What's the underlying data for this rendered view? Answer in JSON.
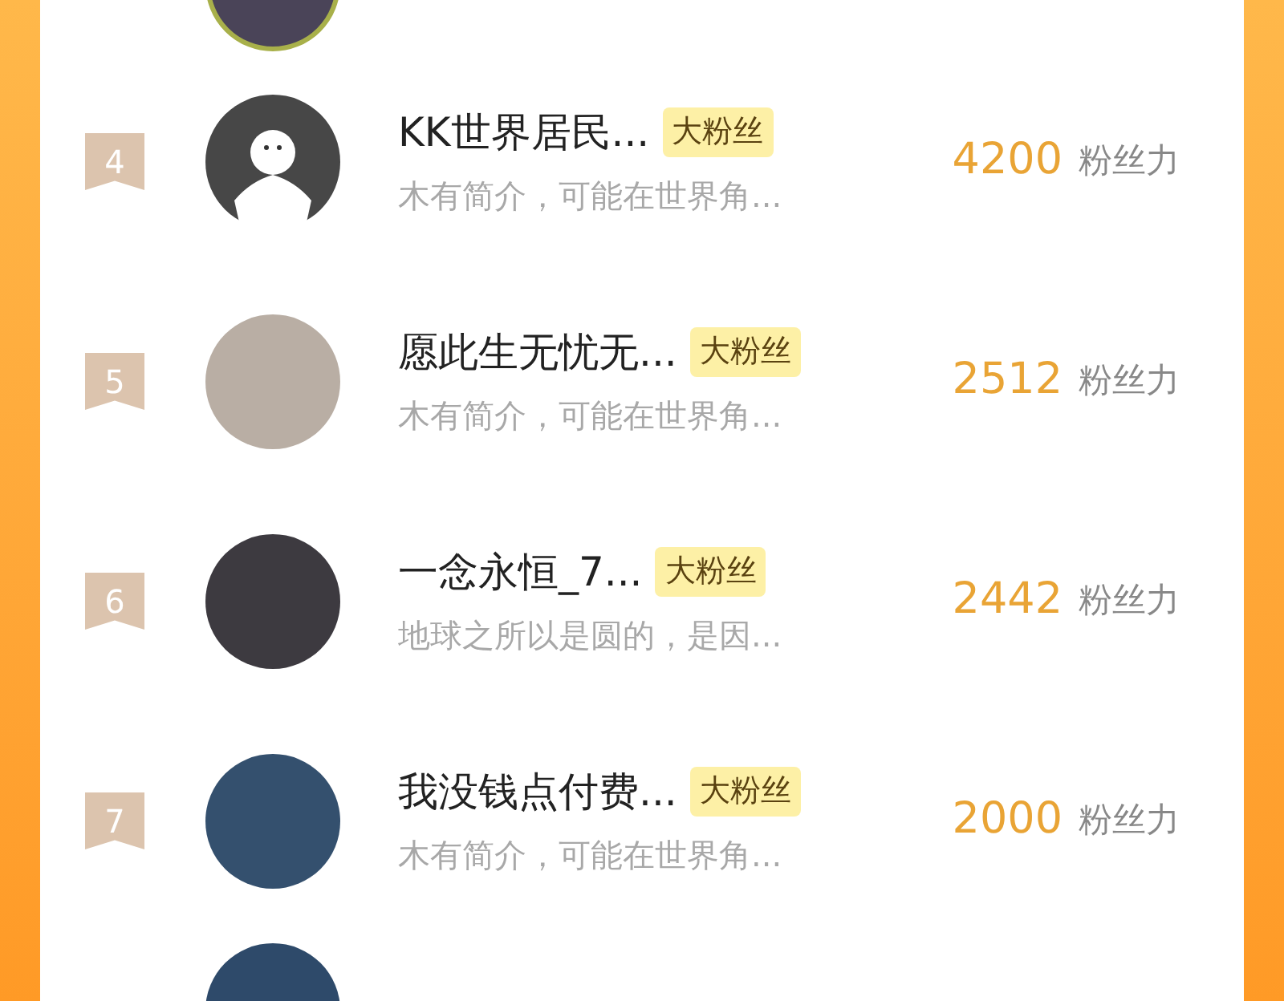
{
  "partial_top": {
    "avatar": {
      "kind": "photo"
    }
  },
  "rows": [
    {
      "rank": "4",
      "avatar": {
        "kind": "silhouette"
      },
      "name": "KK世界居民...",
      "badge": "大粉丝",
      "bio": "木有简介，可能在世界角...",
      "score": "4200",
      "unit": "粉丝力"
    },
    {
      "rank": "5",
      "avatar": {
        "kind": "photo"
      },
      "name": "愿此生无忧无...",
      "badge": "大粉丝",
      "bio": "木有简介，可能在世界角...",
      "score": "2512",
      "unit": "粉丝力"
    },
    {
      "rank": "6",
      "avatar": {
        "kind": "photo"
      },
      "name": "一念永恒_7...",
      "badge": "大粉丝",
      "bio": "地球之所以是圆的，是因...",
      "score": "2442",
      "unit": "粉丝力"
    },
    {
      "rank": "7",
      "avatar": {
        "kind": "photo"
      },
      "name": "我没钱点付费...",
      "badge": "大粉丝",
      "bio": "木有简介，可能在世界角...",
      "score": "2000",
      "unit": "粉丝力"
    }
  ],
  "partial_bottom": {
    "avatar": {
      "kind": "photo"
    }
  }
}
